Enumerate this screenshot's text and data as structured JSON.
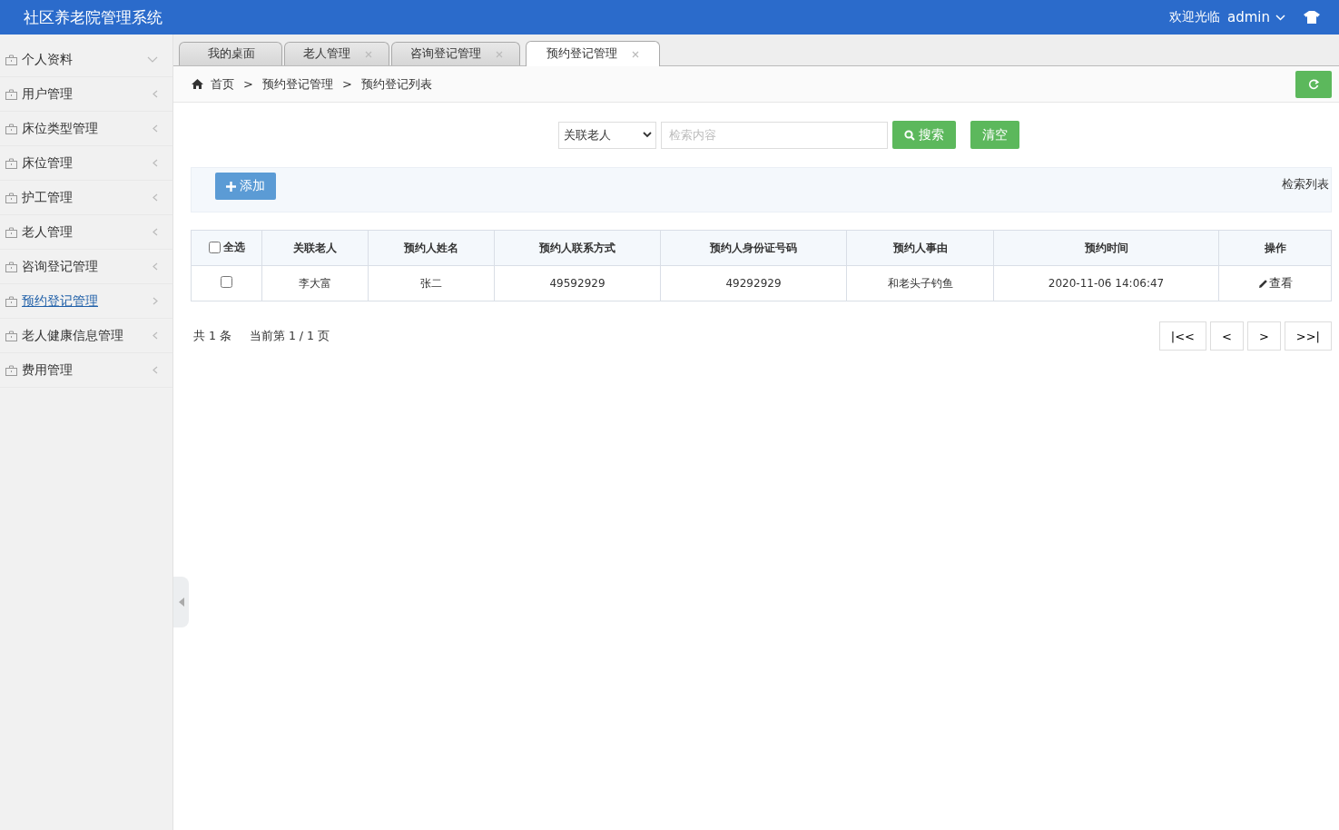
{
  "header": {
    "title": "社区养老院管理系统",
    "welcome": "欢迎光临",
    "user": "admin"
  },
  "sidebar": {
    "items": [
      {
        "label": "个人资料",
        "expanded": true,
        "selected": false
      },
      {
        "label": "用户管理",
        "expanded": false,
        "selected": false
      },
      {
        "label": "床位类型管理",
        "expanded": false,
        "selected": false
      },
      {
        "label": "床位管理",
        "expanded": false,
        "selected": false
      },
      {
        "label": "护工管理",
        "expanded": false,
        "selected": false
      },
      {
        "label": "老人管理",
        "expanded": false,
        "selected": false
      },
      {
        "label": "咨询登记管理",
        "expanded": false,
        "selected": false
      },
      {
        "label": "预约登记管理",
        "expanded": false,
        "selected": true
      },
      {
        "label": "老人健康信息管理",
        "expanded": false,
        "selected": false
      },
      {
        "label": "费用管理",
        "expanded": false,
        "selected": false
      }
    ]
  },
  "tabs": [
    {
      "label": "我的桌面",
      "closable": false,
      "selected": false
    },
    {
      "label": "老人管理",
      "closable": true,
      "selected": false
    },
    {
      "label": "咨询登记管理",
      "closable": true,
      "selected": false
    },
    {
      "label": "预约登记管理",
      "closable": true,
      "selected": true
    }
  ],
  "breadcrumb": {
    "items": [
      "首页",
      "预约登记管理",
      "预约登记列表"
    ],
    "separator": ">"
  },
  "search": {
    "field": "关联老人",
    "placeholder": "检索内容",
    "search_button": "搜索",
    "clear_button": "清空"
  },
  "toolbar": {
    "add_button": "添加",
    "title": "检索列表"
  },
  "table": {
    "select_all": {
      "label": "全选",
      "checked": false
    },
    "columns": [
      "关联老人",
      "预约人姓名",
      "预约人联系方式",
      "预约人身份证号码",
      "预约人事由",
      "预约时间",
      "操作"
    ],
    "rows": [
      {
        "checked": false,
        "cells": [
          "李大富",
          "张二",
          "49592929",
          "49292929",
          "和老头子钓鱼",
          "2020-11-06 14:06:47"
        ],
        "action": "查看"
      }
    ]
  },
  "pagination": {
    "total": "共 1 条",
    "current": "当前第 1 / 1 页",
    "buttons": [
      "|<<",
      "<",
      ">",
      ">>|"
    ]
  }
}
